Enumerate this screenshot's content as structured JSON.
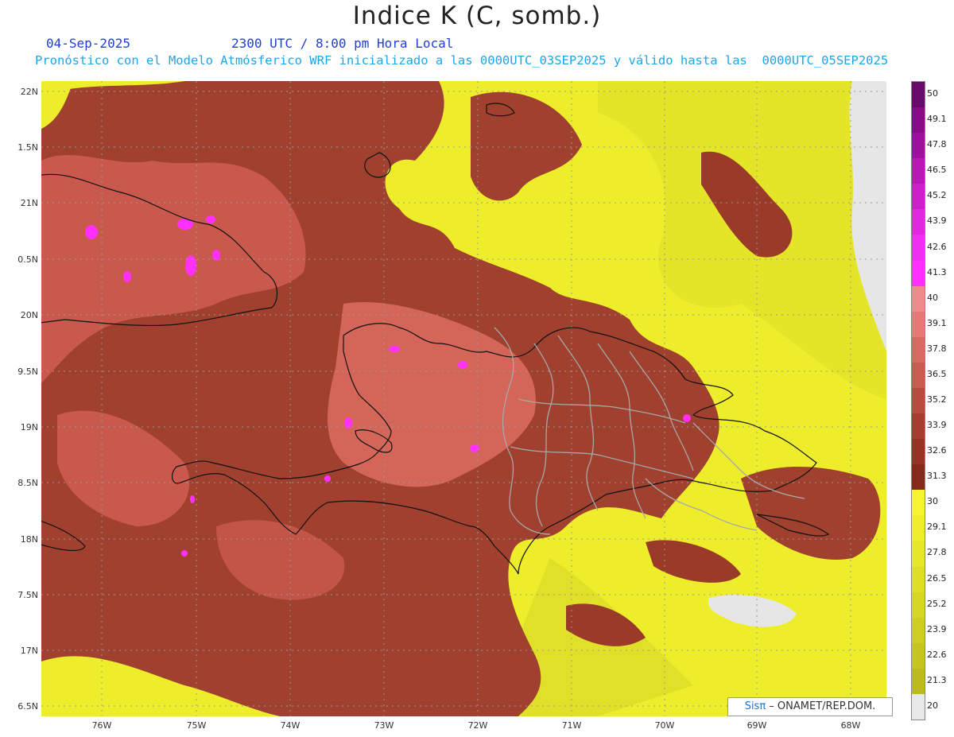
{
  "header": {
    "title": "Indice K (C, somb.)",
    "date": "04-Sep-2025",
    "time": "2300 UTC / 8:00 pm Hora Local",
    "forecast": "Pronóstico con el Modelo Atmósferico WRF inicializado a las 0000UTC_03SEP2025 y válido hasta las  0000UTC_05SEP2025"
  },
  "axes": {
    "lat_labels": [
      "22N",
      "1.5N",
      "21N",
      "0.5N",
      "20N",
      "9.5N",
      "19N",
      "8.5N",
      "18N",
      "7.5N",
      "17N",
      "6.5N"
    ],
    "lon_labels": [
      "76W",
      "75W",
      "74W",
      "73W",
      "72W",
      "71W",
      "70W",
      "69W",
      "68W"
    ]
  },
  "colorbar": {
    "labels": [
      "50",
      "49.1",
      "47.8",
      "46.5",
      "45.2",
      "43.9",
      "42.6",
      "41.3",
      "40",
      "39.1",
      "37.8",
      "36.5",
      "35.2",
      "33.9",
      "32.6",
      "31.3",
      "30",
      "29.1",
      "27.8",
      "26.5",
      "25.2",
      "23.9",
      "22.6",
      "21.3",
      "20"
    ],
    "colors": [
      "#6a0a6a",
      "#8a0a8a",
      "#a010a0",
      "#b818b8",
      "#cc20cc",
      "#e028e0",
      "#f030f0",
      "#ff30ff",
      "#f08a8a",
      "#e87878",
      "#d86a62",
      "#c95a50",
      "#b84a3e",
      "#a83c30",
      "#983224",
      "#86291a",
      "#f4f432",
      "#eeee2e",
      "#e6e62a",
      "#dede28",
      "#d6d626",
      "#cdcd24",
      "#c4c422",
      "#bbbb20",
      "#e8e8e8"
    ]
  },
  "credit": {
    "brand": "Sisπ",
    "text": " – ONAMET/REP.DOM."
  }
}
